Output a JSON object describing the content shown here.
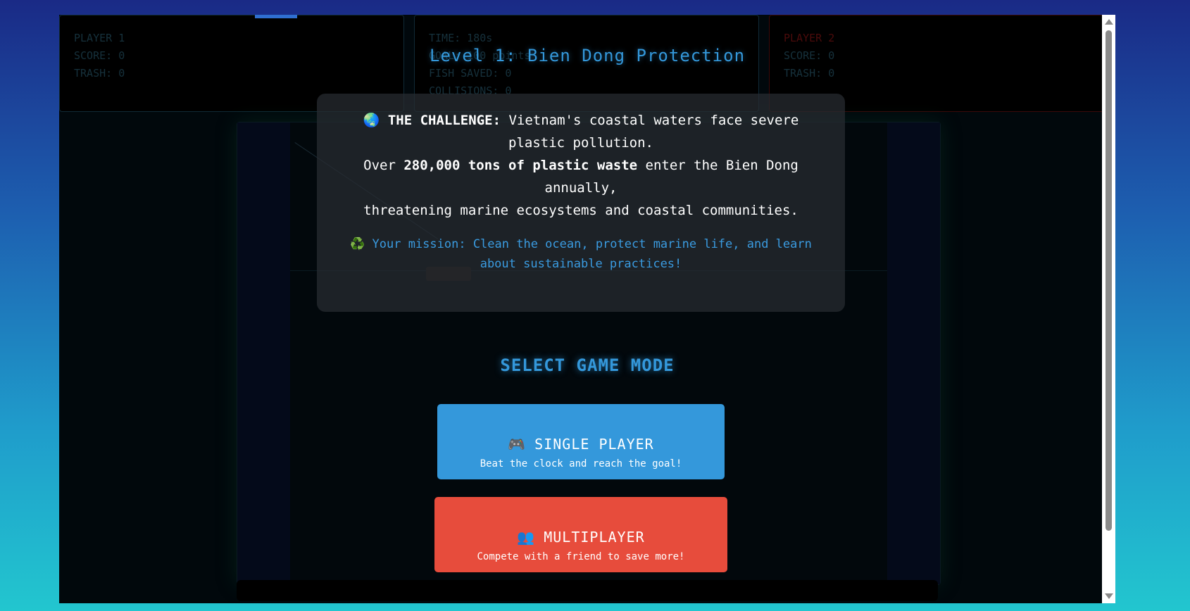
{
  "hud": {
    "player1": {
      "name": "PLAYER 1",
      "score": "SCORE: 0",
      "trash": "TRASH: 0"
    },
    "middle": {
      "time": "TIME: 180s",
      "goal": "GOAL: 100 points",
      "fish_saved": "FISH SAVED: 0",
      "collisions": "COLLISIONS: 0"
    },
    "player2": {
      "name": "PLAYER 2",
      "score": "SCORE: 0",
      "trash": "TRASH: 0"
    }
  },
  "overlay": {
    "level_title": "Level 1: Bien Dong Protection",
    "story": {
      "globe_icon": "🌏",
      "challenge_label": "THE CHALLENGE:",
      "challenge_text": " Vietnam's coastal waters face severe plastic pollution.",
      "over_prefix": "Over ",
      "plastic_amount": "280,000 tons of plastic waste",
      "over_suffix": " enter the Bien Dong annually,",
      "threat_line": "threatening marine ecosystems and coastal communities.",
      "recycle_icon": "♻️",
      "mission_text": " Your mission: Clean the ocean, protect marine life, and learn about sustainable practices!"
    },
    "mode_title": "SELECT GAME MODE",
    "single": {
      "icon": "🎮",
      "label": "SINGLE PLAYER",
      "sub": "Beat the clock and reach the goal!"
    },
    "multi": {
      "icon": "👥",
      "label": "MULTIPLAYER",
      "sub": "Compete with a friend to save more!"
    }
  },
  "colors": {
    "accent": "#3498db",
    "single_button": "#3498db",
    "multi_button": "#e74c3c"
  }
}
